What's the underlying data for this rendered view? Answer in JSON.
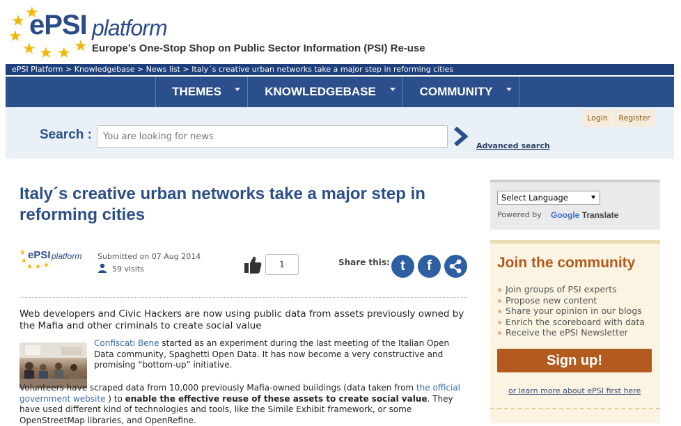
{
  "header": {
    "logo_epsi": "ePSI",
    "logo_platform": "platform",
    "tagline": "Europe’s One-Stop Shop on Public Sector Information (PSI) Re-use"
  },
  "breadcrumb": "ePSI Platform > Knowledgebase > News list > Italy´s creative urban networks take a major step in reforming cities",
  "nav": {
    "items": [
      {
        "label": "THEMES"
      },
      {
        "label": "KNOWLEDGEBASE"
      },
      {
        "label": "COMMUNITY"
      }
    ]
  },
  "search": {
    "label": "Search :",
    "placeholder": "You are looking for news",
    "advanced": "Advanced search"
  },
  "auth": {
    "login": "Login",
    "register": "Register"
  },
  "article": {
    "title": "Italy´s creative urban networks take a major step in reforming cities",
    "meta_logo_epsi": "ePSI",
    "meta_logo_platform": "platform",
    "submitted": "Submitted on 07 Aug 2014",
    "visits": "59 visits",
    "likes": "1",
    "share_label": "Share this:",
    "lead": "Web developers and Civic Hackers are now using public data from assets previously owned by the Mafia and other criminals to create social value",
    "p1_link": "Confiscati Bene",
    "p1_text": " started as an experiment during the last meeting of the Italian Open Data community, Spaghetti Open Data. It has now become a very constructive and promising “bottom-up” initiative.",
    "p2_a": "Volunteers have scraped data from 10,000 previously Mafia-owned buildings (data taken from ",
    "p2_link": "the official government website",
    "p2_b": " ) to ",
    "p2_bold": "enable the effective reuse of these assets to create social value",
    "p2_c": ". They have used different kind of technologies and tools, like the Simile Exhibit framework, or some OpenStreetMap libraries, and OpenRefine."
  },
  "sidebar": {
    "language_select": "Select Language",
    "powered_by": "Powered by",
    "google": "Google",
    "translate": "Translate",
    "community_title": "Join the community",
    "community_items": [
      "Join groups of PSI experts",
      "Propose new content",
      "Share your opinion in our blogs",
      "Enrich the scoreboard with data",
      "Receive the ePSI Newsletter"
    ],
    "signup": "Sign up!",
    "learn_more": "or learn more about ePSI first here"
  },
  "colors": {
    "brand_blue": "#2b4f8a",
    "breadcrumb_bg": "#1f3f7a",
    "accent_orange": "#b35a1f",
    "share_blue": "#2e5fa3"
  }
}
